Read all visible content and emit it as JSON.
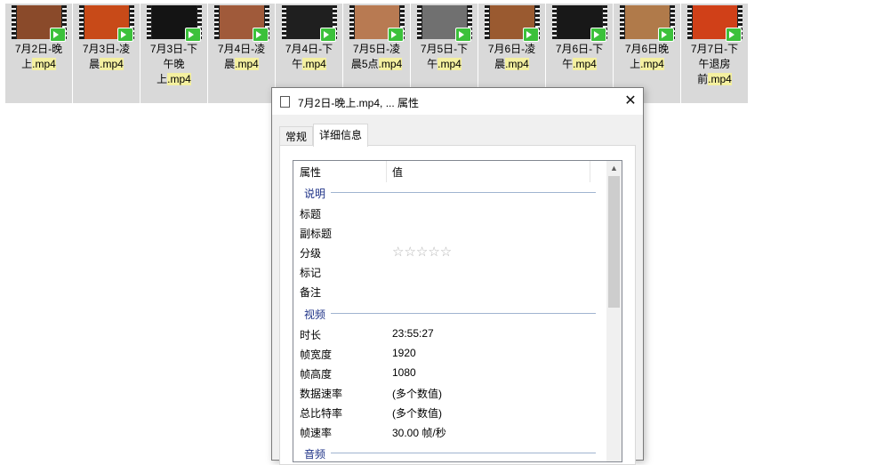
{
  "files": [
    {
      "name_a": "7月2日-晚",
      "name_b": "上",
      "ext": ".mp4",
      "thumb": "#8a4a2a"
    },
    {
      "name_a": "7月3日-凌",
      "name_b": "晨",
      "ext": ".mp4",
      "thumb": "#c84a18"
    },
    {
      "name_a": "7月3日-下",
      "name_b": "午晚上",
      "ext": ".mp4",
      "thumb": "#141414"
    },
    {
      "name_a": "7月4日-凌",
      "name_b": "晨",
      "ext": ".mp4",
      "thumb": "#a05a3a"
    },
    {
      "name_a": "7月4日-下",
      "name_b": "午",
      "ext": ".mp4",
      "thumb": "#1f1f1f"
    },
    {
      "name_a": "7月5日-凌",
      "name_b": "晨5点",
      "ext": ".mp4",
      "thumb": "#b87a52"
    },
    {
      "name_a": "7月5日-下",
      "name_b": "午",
      "ext": ".mp4",
      "thumb": "#707070"
    },
    {
      "name_a": "7月6日-凌",
      "name_b": "晨",
      "ext": ".mp4",
      "thumb": "#9a5a30"
    },
    {
      "name_a": "7月6日-下",
      "name_b": "午",
      "ext": ".mp4",
      "thumb": "#181818"
    },
    {
      "name_a": "7月6日晚",
      "name_b": "上",
      "ext": ".mp4",
      "thumb": "#b07a4a"
    },
    {
      "name_a": "7月7日-下",
      "name_b": "午退房前",
      "ext": ".mp4",
      "thumb": "#d04018"
    }
  ],
  "dialog": {
    "title": "7月2日-晚上.mp4, ... 属性",
    "close": "✕",
    "tabs": [
      "常规",
      "详细信息"
    ],
    "header_property": "属性",
    "header_value": "值",
    "sections": {
      "description": "说明",
      "video": "视频",
      "audio": "音频"
    },
    "desc_rows": [
      "标题",
      "副标题",
      "分级",
      "标记",
      "备注"
    ],
    "rating_stars": "☆☆☆☆☆",
    "rating": 0,
    "video_rows": [
      {
        "label": "时长",
        "value": "23:55:27"
      },
      {
        "label": "帧宽度",
        "value": "1920"
      },
      {
        "label": "帧高度",
        "value": "1080"
      },
      {
        "label": "数据速率",
        "value": "(多个数值)"
      },
      {
        "label": "总比特率",
        "value": "(多个数值)"
      },
      {
        "label": "帧速率",
        "value": "30.00 帧/秒"
      }
    ],
    "scroll_up": "▲"
  }
}
